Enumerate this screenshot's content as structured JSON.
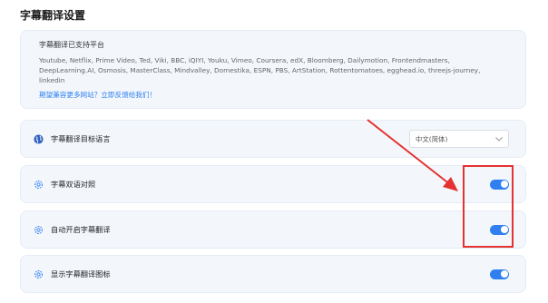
{
  "page": {
    "title": "字幕翻译设置"
  },
  "supported": {
    "title": "字幕翻译已支持平台",
    "platforms": "Youtube, Netflix, Prime Video, Ted, Viki, BBC, iQIYI, Youku, Vimeo, Coursera, edX, Bloomberg, Dailymotion, Frontendmasters, DeepLearning.AI, Osmosis, MasterClass, Mindvalley, Domestika, ESPN, PBS, ArtStation, Rottentomatoes, egghead.io, threejs-journey, linkedin",
    "feedback_link": "期望兼容更多网站？立即反馈给我们！"
  },
  "settings": {
    "target_language": {
      "label": "字幕翻译目标语言",
      "value": "中文(简体)",
      "icon": "globe-icon"
    },
    "bilingual": {
      "label": "字幕双语对照",
      "enabled": true,
      "icon": "gear-icon"
    },
    "auto_translate": {
      "label": "自动开启字幕翻译",
      "enabled": true,
      "icon": "gear-icon"
    },
    "show_icon": {
      "label": "显示字幕翻译图标",
      "enabled": true,
      "icon": "gear-icon"
    }
  },
  "colors": {
    "accent": "#2f7ff0",
    "annotation": "#e3322f",
    "card_bg": "#f3f7fc"
  }
}
